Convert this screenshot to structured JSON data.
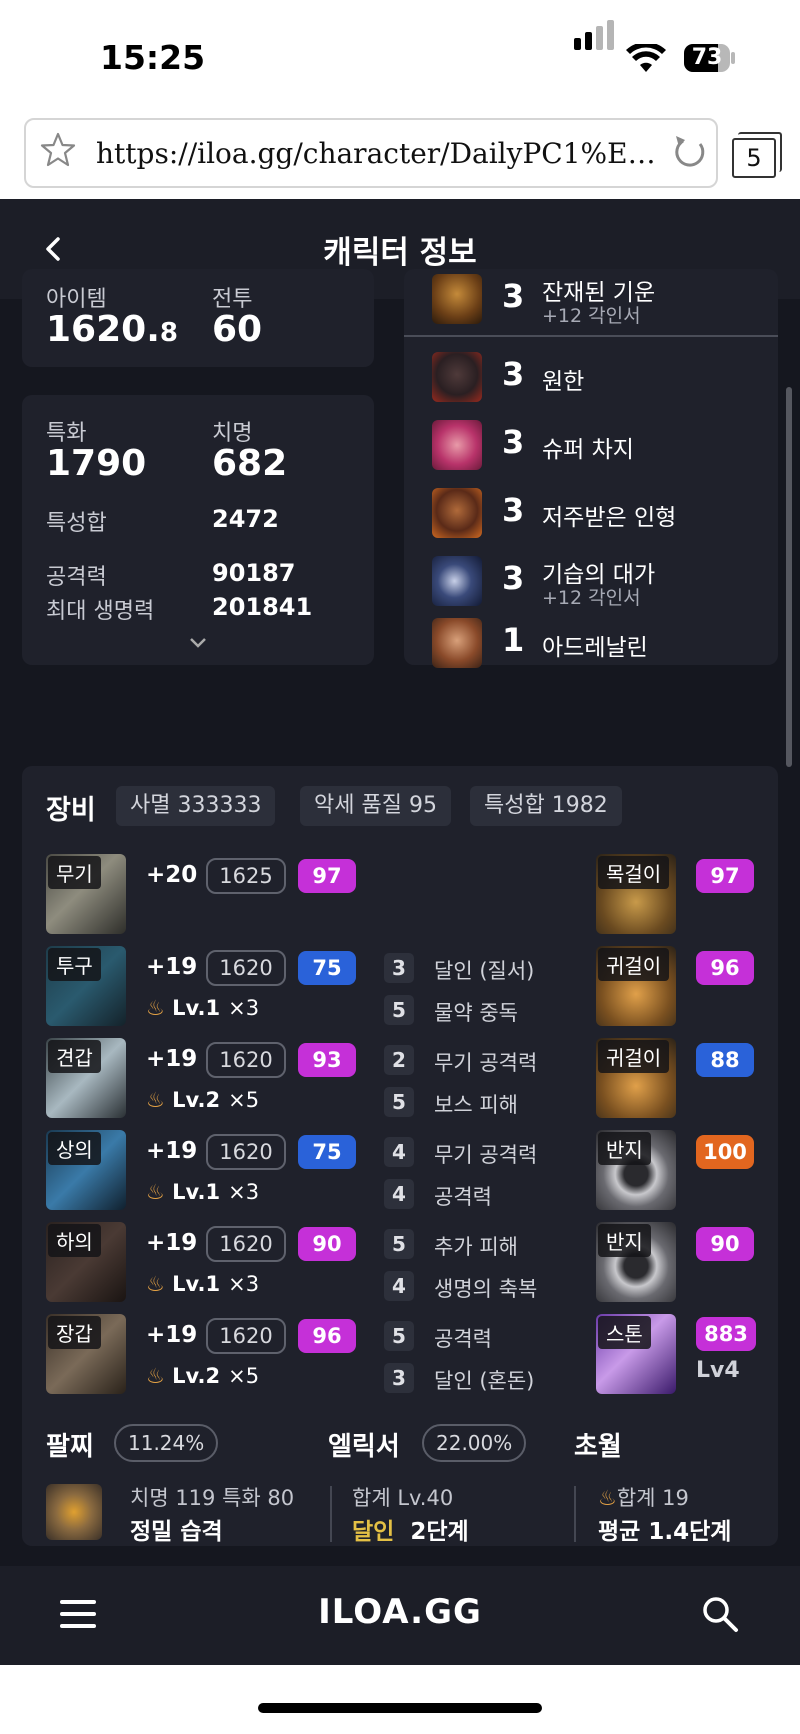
{
  "status_bar": {
    "time": "15:25",
    "battery": "73",
    "battery_level": 0.73
  },
  "browser": {
    "url": "https://iloa.gg/character/DailyPC1%ED%9…",
    "tab_count": "5"
  },
  "header": {
    "title": "캐릭터 정보"
  },
  "item_card": {
    "item_label": "아이템",
    "item_level_main": "1620.",
    "item_level_frac": "8",
    "combat_label": "전투",
    "combat_level": "60"
  },
  "stats_card": {
    "spec_label": "특화",
    "spec_value": "1790",
    "crit_label": "치명",
    "crit_value": "682",
    "total_label": "특성합",
    "total_value": "2472",
    "atk_label": "공격력",
    "atk_value": "90187",
    "hp_label": "최대 생명력",
    "hp_value": "201841"
  },
  "engravings": [
    {
      "level": "3",
      "name": "잔재된 기운",
      "sub": "+12 각인서"
    },
    {
      "level": "3",
      "name": "원한"
    },
    {
      "level": "3",
      "name": "슈퍼 차지"
    },
    {
      "level": "3",
      "name": "저주받은 인형"
    },
    {
      "level": "3",
      "name": "기습의 대가",
      "sub": "+12 각인서"
    },
    {
      "level": "1",
      "name": "아드레날린"
    }
  ],
  "equipment": {
    "title": "장비",
    "chips": [
      "사멸 333333",
      "악세 품질 95",
      "특성합 1982"
    ],
    "armor": [
      {
        "slot": "무기",
        "hone": "+20",
        "ilvl": "1625",
        "quality": "97"
      },
      {
        "slot": "투구",
        "hone": "+19",
        "ilvl": "1620",
        "quality": "75",
        "trans_lv": "Lv.1",
        "trans_x": "×3"
      },
      {
        "slot": "견갑",
        "hone": "+19",
        "ilvl": "1620",
        "quality": "93",
        "trans_lv": "Lv.2",
        "trans_x": "×5"
      },
      {
        "slot": "상의",
        "hone": "+19",
        "ilvl": "1620",
        "quality": "75",
        "trans_lv": "Lv.1",
        "trans_x": "×3"
      },
      {
        "slot": "하의",
        "hone": "+19",
        "ilvl": "1620",
        "quality": "90",
        "trans_lv": "Lv.1",
        "trans_x": "×3"
      },
      {
        "slot": "장갑",
        "hone": "+19",
        "ilvl": "1620",
        "quality": "96",
        "trans_lv": "Lv.2",
        "trans_x": "×5"
      }
    ],
    "effects": [
      {
        "n": "3",
        "t": "달인 (질서)"
      },
      {
        "n": "5",
        "t": "물약 중독"
      },
      {
        "n": "2",
        "t": "무기 공격력"
      },
      {
        "n": "5",
        "t": "보스 피해"
      },
      {
        "n": "4",
        "t": "무기 공격력"
      },
      {
        "n": "4",
        "t": "공격력"
      },
      {
        "n": "5",
        "t": "추가 피해"
      },
      {
        "n": "4",
        "t": "생명의 축복"
      },
      {
        "n": "5",
        "t": "공격력"
      },
      {
        "n": "3",
        "t": "달인 (혼돈)"
      }
    ],
    "accessories": [
      {
        "slot": "목걸이",
        "quality": "97"
      },
      {
        "slot": "귀걸이",
        "quality": "96"
      },
      {
        "slot": "귀걸이",
        "quality": "88"
      },
      {
        "slot": "반지",
        "quality": "100"
      },
      {
        "slot": "반지",
        "quality": "90"
      },
      {
        "slot": "스톤",
        "quality": "883",
        "extra": "Lv4"
      }
    ],
    "bracelet": {
      "title": "팔찌",
      "pct": "11.24%",
      "line1": "치명 119  특화 80",
      "line2": "정밀  습격"
    },
    "elixir": {
      "title": "엘릭서",
      "pct": "22.00%",
      "line1": "합계 Lv.40",
      "highlight": "달인",
      "line2": "2단계"
    },
    "transcend": {
      "title": "초월",
      "line1": "합계 19",
      "line2": "평균 1.4단계"
    }
  },
  "bottom_nav": {
    "logo": "ILOA.GG"
  },
  "colors": {
    "bg": "#15171f",
    "card": "#1f212b",
    "purple": "#c530d8",
    "blue": "#2a62d9",
    "orange": "#e2661f",
    "gold": "#e4c045"
  }
}
